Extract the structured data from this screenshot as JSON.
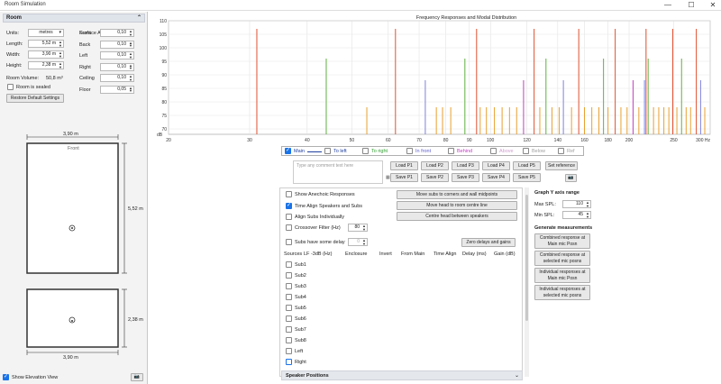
{
  "window": {
    "title": "Room Simulation",
    "minimize": "—",
    "maximize": "☐",
    "close": "✕"
  },
  "room": {
    "header": "Room",
    "units_label": "Units:",
    "units_value": "metres",
    "length_label": "Length:",
    "length_value": "5,52 m",
    "width_label": "Width:",
    "width_value": "3,90 m",
    "height_label": "Height:",
    "height_value": "2,38 m",
    "volume_label": "Room Volume:",
    "volume_value": "50,8 m³",
    "sealed_label": "Room is sealed",
    "restore_button": "Restore Default Settings",
    "absorptions_header": "Surface Absorptions",
    "surfaces": [
      {
        "label": "Front",
        "value": "0,10"
      },
      {
        "label": "Back",
        "value": "0,10"
      },
      {
        "label": "Left",
        "value": "0,10"
      },
      {
        "label": "Right",
        "value": "0,10"
      },
      {
        "label": "Ceiling",
        "value": "0,10"
      },
      {
        "label": "Floor",
        "value": "0,05"
      }
    ]
  },
  "plan": {
    "top_dim": "3,90 m",
    "front_label": "Front",
    "side_dim": "5,52 m",
    "elev_top_dim": "",
    "elev_side_dim": "2,38 m",
    "elev_bottom_dim": "3,90 m",
    "show_elevation_label": "Show Elevation View"
  },
  "chart_data": {
    "type": "bar",
    "title": "Frequency Responses and Modal Distribution",
    "xlabel": "",
    "ylabel": "dB",
    "x_scale": "log",
    "xlim": [
      20,
      300
    ],
    "ylim": [
      68,
      110
    ],
    "x_ticks": [
      "20",
      "30",
      "40",
      "50",
      "60",
      "70",
      "80",
      "90",
      "100",
      "120",
      "140",
      "160",
      "180",
      "200",
      "250",
      "300 Hz"
    ],
    "x_tick_values": [
      20,
      30,
      40,
      50,
      60,
      70,
      80,
      90,
      100,
      120,
      140,
      160,
      180,
      200,
      250,
      300
    ],
    "y_ticks": [
      "70",
      "75",
      "80",
      "85",
      "90",
      "95",
      "100",
      "105",
      "110"
    ],
    "y_tick_values": [
      70,
      75,
      80,
      85,
      90,
      95,
      100,
      105,
      110
    ],
    "y_axis_unit": "dB",
    "modes": [
      {
        "f": 31.1,
        "level": 107,
        "color": "#e05030"
      },
      {
        "f": 44.0,
        "level": 96,
        "color": "#60b040"
      },
      {
        "f": 53.9,
        "level": 78,
        "color": "#e8a030"
      },
      {
        "f": 62.2,
        "level": 107,
        "color": "#e05030"
      },
      {
        "f": 72.2,
        "level": 88,
        "color": "#8080e0"
      },
      {
        "f": 76.3,
        "level": 78,
        "color": "#e8a030"
      },
      {
        "f": 78.7,
        "level": 78,
        "color": "#e8a030"
      },
      {
        "f": 82.0,
        "level": 78,
        "color": "#e8a030"
      },
      {
        "f": 88.0,
        "level": 96,
        "color": "#60b040"
      },
      {
        "f": 93.3,
        "level": 107,
        "color": "#e05030"
      },
      {
        "f": 95.0,
        "level": 78,
        "color": "#e8a030"
      },
      {
        "f": 98.0,
        "level": 78,
        "color": "#e8a030"
      },
      {
        "f": 102.0,
        "level": 78,
        "color": "#e8a030"
      },
      {
        "f": 106.0,
        "level": 78,
        "color": "#e8a030"
      },
      {
        "f": 110.0,
        "level": 78,
        "color": "#e8a030"
      },
      {
        "f": 114.0,
        "level": 78,
        "color": "#e8a030"
      },
      {
        "f": 118.0,
        "level": 88,
        "color": "#c040c0"
      },
      {
        "f": 124.4,
        "level": 107,
        "color": "#e05030"
      },
      {
        "f": 128.0,
        "level": 78,
        "color": "#e8a030"
      },
      {
        "f": 132.0,
        "level": 96,
        "color": "#60b040"
      },
      {
        "f": 136.0,
        "level": 78,
        "color": "#e8a030"
      },
      {
        "f": 141.0,
        "level": 78,
        "color": "#e8a030"
      },
      {
        "f": 144.0,
        "level": 88,
        "color": "#8080e0"
      },
      {
        "f": 150.0,
        "level": 78,
        "color": "#e8a030"
      },
      {
        "f": 155.5,
        "level": 107,
        "color": "#e05030"
      },
      {
        "f": 160.0,
        "level": 78,
        "color": "#e8a030"
      },
      {
        "f": 166.0,
        "level": 78,
        "color": "#e8a030"
      },
      {
        "f": 172.0,
        "level": 78,
        "color": "#e8a030"
      },
      {
        "f": 176.0,
        "level": 96,
        "color": "#60b040"
      },
      {
        "f": 180.0,
        "level": 78,
        "color": "#e8a030"
      },
      {
        "f": 186.6,
        "level": 107,
        "color": "#e05030"
      },
      {
        "f": 192.0,
        "level": 78,
        "color": "#e8a030"
      },
      {
        "f": 198.0,
        "level": 78,
        "color": "#e8a030"
      },
      {
        "f": 204.0,
        "level": 88,
        "color": "#c040c0"
      },
      {
        "f": 210.0,
        "level": 78,
        "color": "#e8a030"
      },
      {
        "f": 216.0,
        "level": 88,
        "color": "#8080e0"
      },
      {
        "f": 217.7,
        "level": 107,
        "color": "#e05030"
      },
      {
        "f": 220.0,
        "level": 96,
        "color": "#60b040"
      },
      {
        "f": 226.0,
        "level": 78,
        "color": "#e8a030"
      },
      {
        "f": 232.0,
        "level": 78,
        "color": "#e8a030"
      },
      {
        "f": 238.0,
        "level": 78,
        "color": "#e8a030"
      },
      {
        "f": 244.0,
        "level": 78,
        "color": "#e8a030"
      },
      {
        "f": 248.8,
        "level": 107,
        "color": "#e05030"
      },
      {
        "f": 254.0,
        "level": 78,
        "color": "#e8a030"
      },
      {
        "f": 260.0,
        "level": 96,
        "color": "#60b040"
      },
      {
        "f": 266.0,
        "level": 78,
        "color": "#e8a030"
      },
      {
        "f": 272.0,
        "level": 78,
        "color": "#e8a030"
      },
      {
        "f": 279.9,
        "level": 107,
        "color": "#e05030"
      },
      {
        "f": 286.0,
        "level": 88,
        "color": "#8080e0"
      },
      {
        "f": 292.0,
        "level": 78,
        "color": "#e8a030"
      }
    ]
  },
  "legend": [
    {
      "label": "Main",
      "checked": true,
      "color": "#2040a0"
    },
    {
      "label": "To left",
      "checked": false,
      "color": "#2040a0"
    },
    {
      "label": "To right",
      "checked": false,
      "color": "#30a030"
    },
    {
      "label": "In front",
      "checked": false,
      "color": "#6060d0"
    },
    {
      "label": "Behind",
      "checked": false,
      "color": "#c040c0"
    },
    {
      "label": "Above",
      "checked": false,
      "color": "#d0a0d0"
    },
    {
      "label": "Below",
      "checked": false,
      "color": "#a0a0a0"
    },
    {
      "label": "Ref",
      "checked": false,
      "color": "#a0a0a0"
    }
  ],
  "comment_placeholder": "Type any comment text here",
  "load_buttons": [
    "Load P1",
    "Load P2",
    "Load P3",
    "Load P4",
    "Load P5"
  ],
  "save_buttons": [
    "Save P1",
    "Save P2",
    "Save P3",
    "Save P4",
    "Save P5"
  ],
  "set_reference": "Set reference",
  "options": {
    "show_anechoic": "Show Anechoic Responses",
    "time_align": "Time Align Speakers and Subs",
    "align_subs": "Align Subs Individually",
    "crossover": "Crossover Filter (Hz)",
    "crossover_value": "80",
    "subs_delay": "Subs have some delay",
    "subs_delay_value": "0",
    "move_subs": "Move subs to corners and wall midpoints",
    "move_head": "Move head to room centre line",
    "centre_head": "Centre head between speakers",
    "zero_delays": "Zero delays and gains"
  },
  "table_headers": [
    "Sources",
    "LF -3dB (Hz)",
    "Enclosure",
    "Invert",
    "From Main",
    "Time Align",
    "Delay (ms)",
    "Gain (dB)"
  ],
  "sources": [
    "Sub1",
    "Sub2",
    "Sub3",
    "Sub4",
    "Sub5",
    "Sub6",
    "Sub7",
    "Sub8",
    "Left",
    "Right"
  ],
  "speaker_positions": "Speaker Positions",
  "graph_y": {
    "header": "Graph Y axis range",
    "max_label": "Max SPL:",
    "max_value": "110",
    "min_label": "Min SPL:",
    "min_value": "45"
  },
  "generate": {
    "header": "Generate measurements",
    "buttons": [
      "Combined response at Main mic Posn",
      "Combined response at selected mic posns",
      "Individual responses at Main mic Posn",
      "Individual responses at selected mic posns"
    ]
  }
}
